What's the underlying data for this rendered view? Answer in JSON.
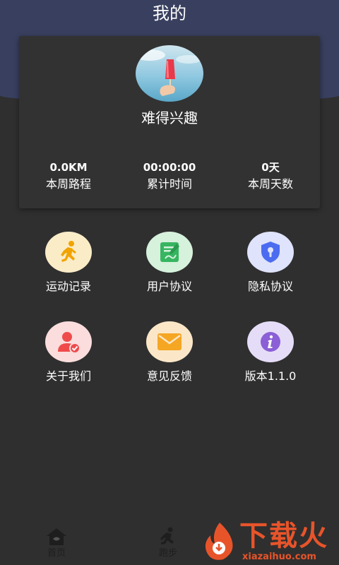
{
  "page": {
    "title": "我的"
  },
  "profile": {
    "nickname": "难得兴趣"
  },
  "stats": [
    {
      "value": "0.0KM",
      "label": "本周路程"
    },
    {
      "value": "00:00:00",
      "label": "累计时间"
    },
    {
      "value": "0天",
      "label": "本周天数"
    }
  ],
  "menu": [
    {
      "label": "运动记录",
      "icon": "running-person-icon",
      "bg": "#fbecc8",
      "fg": "#f1a400"
    },
    {
      "label": "用户协议",
      "icon": "document-edit-icon",
      "bg": "#d6f1dc",
      "fg": "#37b561"
    },
    {
      "label": "隐私协议",
      "icon": "shield-lock-icon",
      "bg": "#dfe3fb",
      "fg": "#4b6cf0"
    },
    {
      "label": "关于我们",
      "icon": "user-check-icon",
      "bg": "#fbdddd",
      "fg": "#ef4b4b"
    },
    {
      "label": "意见反馈",
      "icon": "mail-icon",
      "bg": "#fbe7c8",
      "fg": "#f5a623"
    },
    {
      "label": "版本1.1.0",
      "icon": "info-icon",
      "bg": "#e5ddf7",
      "fg": "#8b5fd6"
    }
  ],
  "tabbar": [
    {
      "label": "首页",
      "icon": "home-icon"
    },
    {
      "label": "跑步",
      "icon": "running-person-icon"
    }
  ],
  "watermark": {
    "title": "下载火",
    "subtitle": "xiazaihuo.com"
  },
  "colors": {
    "header": "#39405f",
    "background": "#2f2f2f",
    "card": "#323232",
    "watermark": "#e8542a"
  }
}
